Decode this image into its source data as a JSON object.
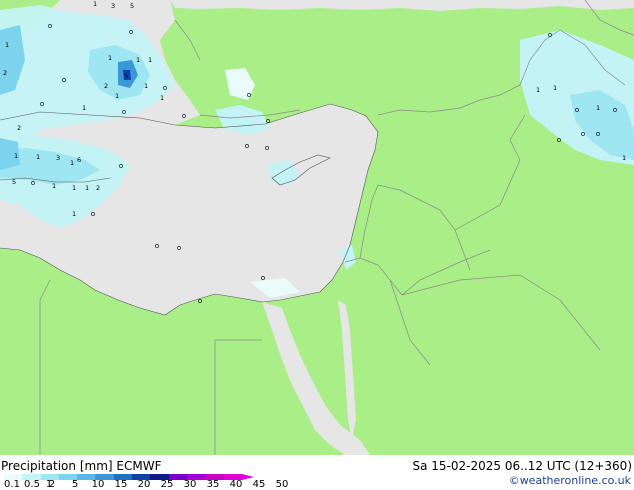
{
  "product": {
    "label": "Precipitation [mm]",
    "model": "ECMWF"
  },
  "valid_time": "Sa 15-02-2025 06..12 UTC (12+360)",
  "credit": "©weatheronline.co.uk",
  "colors": {
    "land": "#aaee88",
    "sea_grey": "#e6e6e6",
    "sea_covered": "#aaee88",
    "borders": "#8a8a8a"
  },
  "legend": {
    "ticks": [
      "0.1",
      "0.5",
      "1",
      "2",
      "5",
      "10",
      "15",
      "20",
      "25",
      "30",
      "35",
      "40",
      "45",
      "50"
    ],
    "colors": [
      "#e9fbfb",
      "#c4f3f6",
      "#9ee6f2",
      "#7cd3ee",
      "#5ab9e6",
      "#3a98d6",
      "#2070c4",
      "#1040a8",
      "#0a1a88",
      "#7a00c8",
      "#a800d4",
      "#c800c8",
      "#e000d8"
    ]
  },
  "map_values": [
    "1",
    "3",
    "5",
    "1",
    "1",
    "2",
    "1",
    "5",
    "2",
    "1",
    "1",
    "1",
    "2",
    "1",
    "3",
    "1",
    "6",
    "1",
    "5",
    "1",
    "1",
    "1",
    "2",
    "1",
    "1",
    "1",
    "1",
    "1",
    "1",
    "1",
    "1",
    "1",
    "1",
    "1",
    "1",
    "1",
    "1",
    "1",
    "1"
  ]
}
